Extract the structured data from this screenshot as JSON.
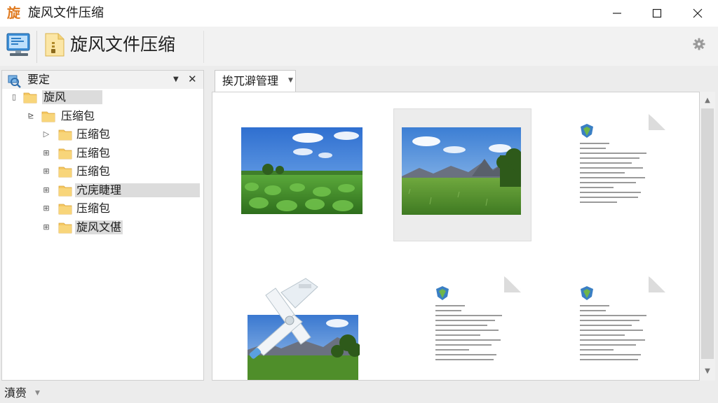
{
  "window": {
    "title": "旋风文件压缩",
    "logo_text": "旋"
  },
  "toolbar": {
    "title": "旋风文件压缩",
    "icons": [
      "computer-icon",
      "archive-file-icon",
      "gear-icon"
    ]
  },
  "left_panel": {
    "title": "要定",
    "tree": [
      {
        "label": "旋风",
        "level": 0,
        "expander": "▯",
        "highlight": true
      },
      {
        "label": "压缩包",
        "level": 1,
        "expander": "⊵",
        "highlight": false
      },
      {
        "label": "压缩包",
        "level": 2,
        "expander": "▷",
        "highlight": false
      },
      {
        "label": "压缩包",
        "level": 2,
        "expander": "⊞",
        "highlight": false
      },
      {
        "label": "压缩包",
        "level": 2,
        "expander": "⊞",
        "highlight": false
      },
      {
        "label": "宂庑睫理",
        "level": 2,
        "expander": "⊞",
        "highlight": true
      },
      {
        "label": "压缩包",
        "level": 2,
        "expander": "⊞",
        "highlight": false
      },
      {
        "label": "旋风文偡",
        "level": 2,
        "expander": "⊞",
        "highlight": true
      }
    ]
  },
  "tab": {
    "label": "挨兀澼管理"
  },
  "status": {
    "text": "濆赍"
  },
  "colors": {
    "folder": "#f5c862",
    "accent_blue": "#2f7fc6",
    "sky": "#3b7fd6",
    "grass": "#4c9a2a"
  }
}
